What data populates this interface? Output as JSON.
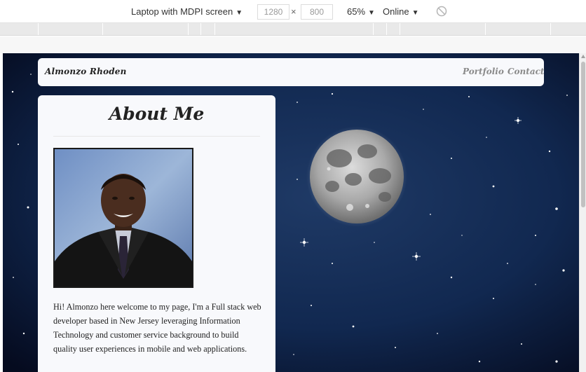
{
  "devtools": {
    "device": "Laptop with MDPI screen",
    "width": "1280",
    "height": "800",
    "times": "×",
    "zoom": "65%",
    "network": "Online",
    "caret": "▼"
  },
  "navbar": {
    "brand": "Almonzo Rhoden",
    "links": [
      "Portfolio",
      "Contact"
    ]
  },
  "about": {
    "title": "About Me",
    "bio": "Hi! Almonzo here welcome to my page, I'm a Full stack web developer based in New Jersey leveraging Information Technology and customer service background to build quality user experiences in mobile and web applications."
  },
  "colors": {
    "sky": "#08122b",
    "panel": "#f8f9fc",
    "link": "#8a8a8a"
  }
}
